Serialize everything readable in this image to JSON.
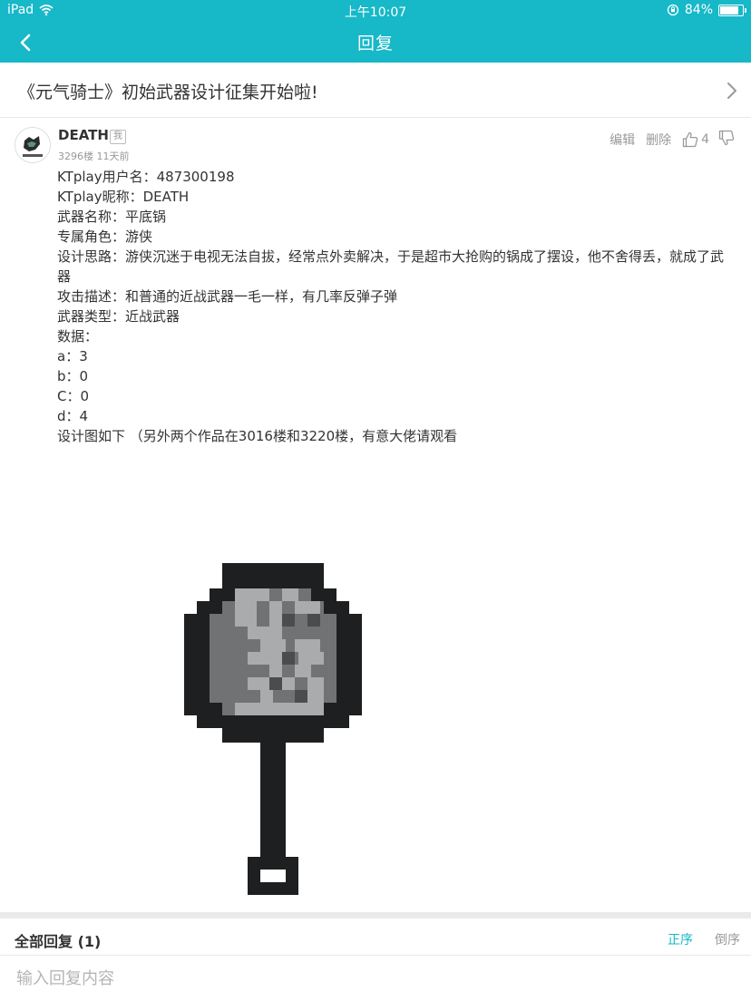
{
  "status_bar": {
    "device": "iPad",
    "time": "上午10:07",
    "battery_level": 0.84,
    "battery_text": "84%"
  },
  "nav": {
    "title": "回复"
  },
  "topic": {
    "title": "《元气骑士》初始武器设计征集开始啦!"
  },
  "post": {
    "username": "DEATH",
    "badge": "我",
    "meta": "3296楼 11天前",
    "actions": {
      "edit": "编辑",
      "delete": "删除",
      "likes": "4"
    },
    "lines": [
      "KTplay用户名：487300198",
      "KTplay昵称：DEATH",
      "武器名称：平底锅",
      "专属角色：游侠",
      "设计思路：游侠沉迷于电视无法自拔，经常点外卖解决，于是超市大抢购的锅成了摆设，他不舍得丢，就成了武器",
      "攻击描述：和普通的近战武器一毛一样，有几率反弹子弹",
      "武器类型：近战武器",
      "数据：",
      "a：3",
      "b：0",
      "C：0",
      "d：4",
      "设计图如下 （另外两个作品在3016楼和3220楼，有意大佬请观看"
    ]
  },
  "replies": {
    "title": "全部回复 (1)",
    "sort_asc": "正序",
    "sort_desc": "倒序"
  },
  "reply_input": {
    "placeholder": "输入回复内容"
  },
  "colors": {
    "accent": "#17b8c8",
    "pan_dark": "#1e1f20",
    "pan_gray": "#707274",
    "pan_light": "#a9abad"
  }
}
